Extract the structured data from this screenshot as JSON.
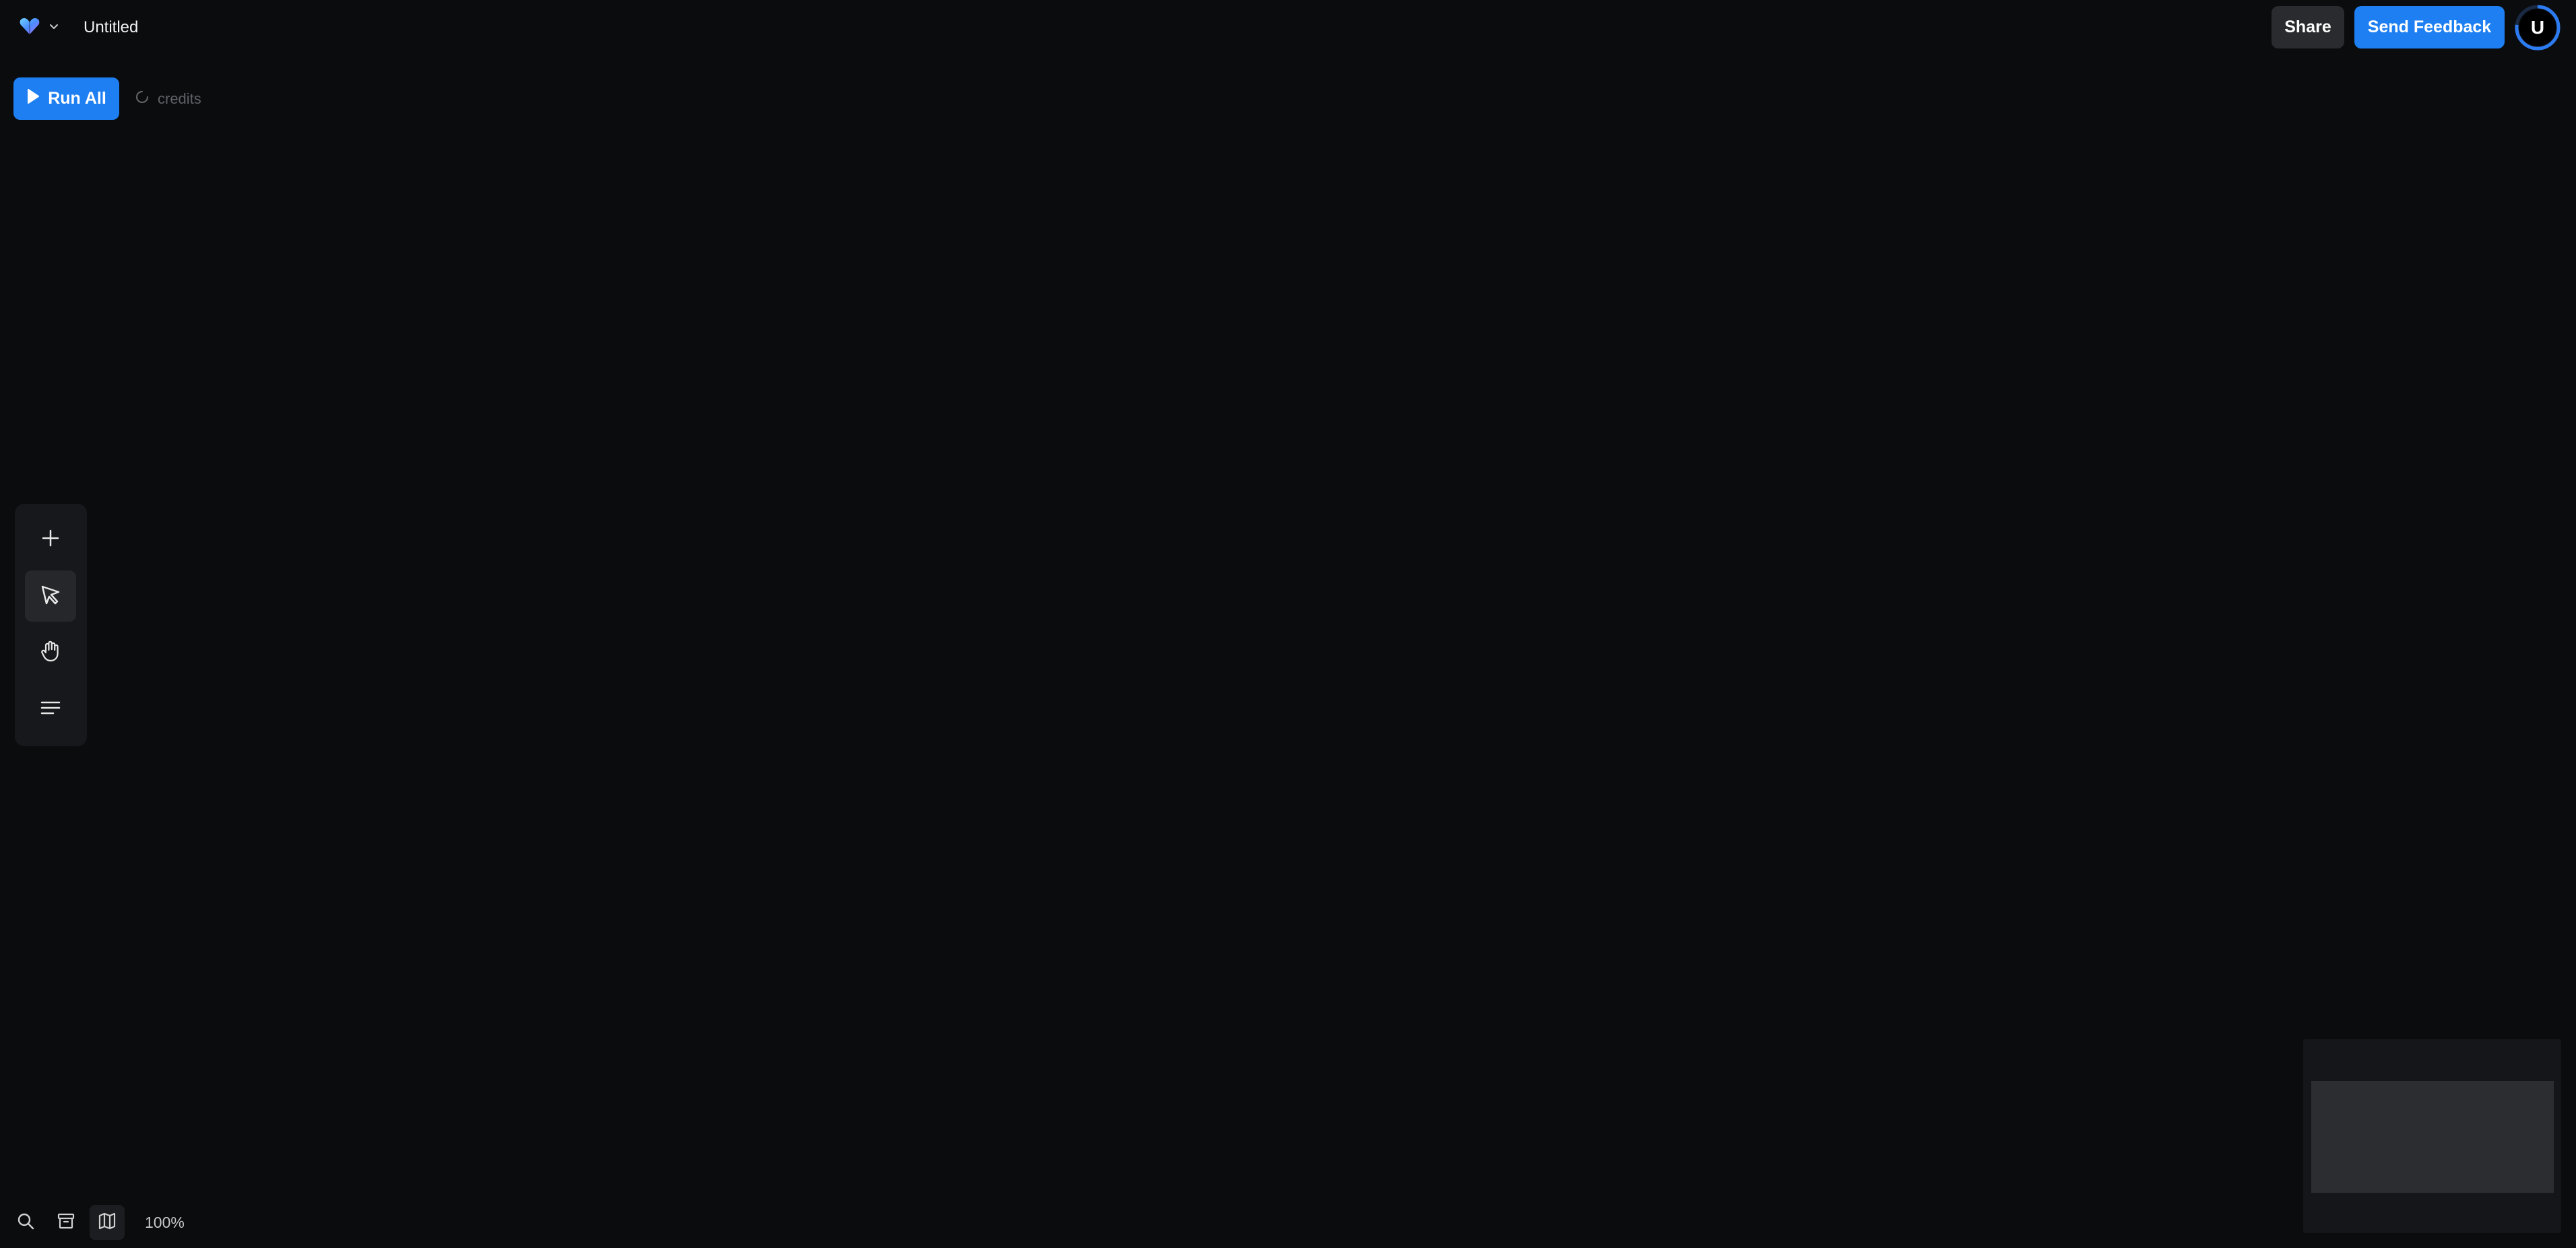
{
  "header": {
    "title": "Untitled",
    "share_label": "Share",
    "feedback_label": "Send Feedback",
    "avatar_initial": "U"
  },
  "actions": {
    "run_all_label": "Run All",
    "credits_label": "credits"
  },
  "toolbar": {
    "tools": [
      {
        "name": "add",
        "icon": "plus-icon",
        "active": false
      },
      {
        "name": "select",
        "icon": "pointer-icon",
        "active": true
      },
      {
        "name": "pan",
        "icon": "hand-icon",
        "active": false
      },
      {
        "name": "outline",
        "icon": "lines-icon",
        "active": false
      }
    ]
  },
  "footer": {
    "icons": [
      "search-icon",
      "archive-icon",
      "map-icon"
    ],
    "zoom_level": "100%"
  },
  "colors": {
    "background": "#0b0c0e",
    "accent": "#1d7ff2",
    "secondary_button": "#2a2b2e"
  }
}
